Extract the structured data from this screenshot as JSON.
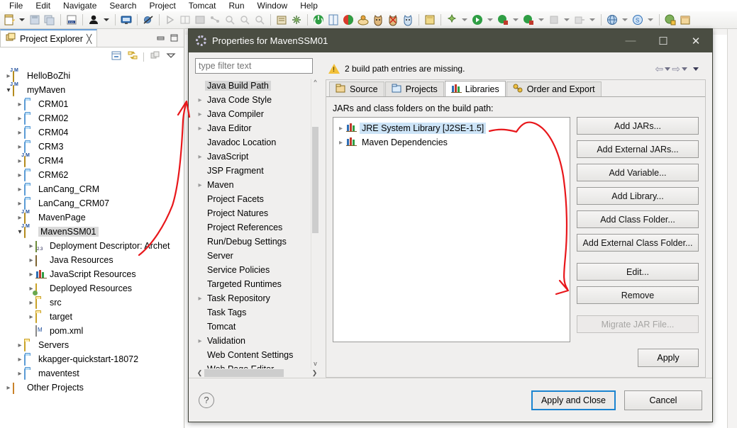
{
  "app": {
    "menu": [
      "File",
      "Edit",
      "Navigate",
      "Search",
      "Project",
      "Tomcat",
      "Run",
      "Window",
      "Help"
    ],
    "toolbar_icons": [
      "new-wizard-icon",
      "new-dropdown-caret",
      "save-icon",
      "save-all-icon",
      "new-java-class-icon",
      "user-icon",
      "user-dropdown-caret",
      "console-icon",
      "skip-breakpoints-icon",
      "run-last-tool-icon",
      "toggle-mark-occurrences-icon",
      "open-type-icon",
      "link-icon",
      "cat-icon-1",
      "cat-icon-2",
      "cat-icon-3",
      "power-icon",
      "perspective-icon",
      "refresh-icon",
      "search-icon-1",
      "search-icon-2",
      "search-icon-3",
      "save-doc-icon",
      "debug-icon",
      "debug-caret",
      "run-icon",
      "run-caret",
      "coverage-icon",
      "coverage-caret",
      "profile-icon",
      "profile-caret",
      "external-tools-icon",
      "external-tools-caret",
      "build-icon",
      "build-caret",
      "web-browser-icon",
      "browser-caret",
      "js-icon",
      "js-caret",
      "open-perspective-icon",
      "perspective-switch-icon"
    ]
  },
  "explorer": {
    "tab_label": "Project Explorer",
    "close_glyph": "╳",
    "minimize_glyph": "—",
    "maximize_glyph": "□",
    "tools": [
      "collapse-all-icon",
      "link-with-editor-icon",
      "focus-on-active-task-icon",
      "view-menu-icon"
    ],
    "tree": [
      {
        "label": "HelloBoZhi",
        "indent": 0,
        "state": "collapsed",
        "icon": "project-web-icon"
      },
      {
        "label": "myMaven",
        "indent": 0,
        "state": "expanded",
        "icon": "project-web-icon"
      },
      {
        "label": "CRM01",
        "indent": 1,
        "state": "collapsed",
        "icon": "folder-blue-icon"
      },
      {
        "label": "CRM02",
        "indent": 1,
        "state": "collapsed",
        "icon": "folder-blue-icon"
      },
      {
        "label": "CRM04",
        "indent": 1,
        "state": "collapsed",
        "icon": "folder-blue-icon"
      },
      {
        "label": "CRM3",
        "indent": 1,
        "state": "collapsed",
        "icon": "folder-blue-icon"
      },
      {
        "label": "CRM4",
        "indent": 1,
        "state": "collapsed",
        "icon": "maven-project-icon"
      },
      {
        "label": "CRM62",
        "indent": 1,
        "state": "collapsed",
        "icon": "folder-blue-icon"
      },
      {
        "label": "LanCang_CRM",
        "indent": 1,
        "state": "collapsed",
        "icon": "folder-blue-icon"
      },
      {
        "label": "LanCang_CRM07",
        "indent": 1,
        "state": "collapsed",
        "icon": "folder-blue-icon"
      },
      {
        "label": "MavenPage",
        "indent": 1,
        "state": "collapsed",
        "icon": "maven-project-icon"
      },
      {
        "label": "MavenSSM01",
        "indent": 1,
        "state": "expanded",
        "icon": "maven-project-icon",
        "selected": true
      },
      {
        "label": "Deployment Descriptor: Archet",
        "indent": 2,
        "state": "collapsed",
        "icon": "deployment-descriptor-icon"
      },
      {
        "label": "Java Resources",
        "indent": 2,
        "state": "collapsed",
        "icon": "java-resources-icon"
      },
      {
        "label": "JavaScript Resources",
        "indent": 2,
        "state": "collapsed",
        "icon": "library-icon"
      },
      {
        "label": "Deployed Resources",
        "indent": 2,
        "state": "collapsed",
        "icon": "deployed-resources-icon"
      },
      {
        "label": "src",
        "indent": 2,
        "state": "collapsed",
        "icon": "folder-open-icon"
      },
      {
        "label": "target",
        "indent": 2,
        "state": "collapsed",
        "icon": "folder-open-icon"
      },
      {
        "label": "pom.xml",
        "indent": 2,
        "state": "leaf",
        "icon": "xml-file-icon"
      },
      {
        "label": "Servers",
        "indent": 1,
        "state": "collapsed",
        "icon": "folder-open-icon"
      },
      {
        "label": "kkapger-quickstart-18072",
        "indent": 1,
        "state": "collapsed",
        "icon": "folder-blue-icon"
      },
      {
        "label": "maventest",
        "indent": 1,
        "state": "collapsed",
        "icon": "folder-blue-icon"
      },
      {
        "label": "Other Projects",
        "indent": 0,
        "state": "collapsed",
        "icon": "other-projects-icon"
      }
    ]
  },
  "dialog": {
    "title": "Properties for MavenSSM01",
    "window_buttons": {
      "minimize": "—",
      "maximize": "☐",
      "close": "✕"
    },
    "filter_placeholder": "type filter text",
    "message": "2 build path entries are missing.",
    "nav": [
      {
        "label": "Java Build Path",
        "expandable": false,
        "selected": true
      },
      {
        "label": "Java Code Style",
        "expandable": true
      },
      {
        "label": "Java Compiler",
        "expandable": true
      },
      {
        "label": "Java Editor",
        "expandable": true
      },
      {
        "label": "Javadoc Location",
        "expandable": false
      },
      {
        "label": "JavaScript",
        "expandable": true
      },
      {
        "label": "JSP Fragment",
        "expandable": false
      },
      {
        "label": "Maven",
        "expandable": true
      },
      {
        "label": "Project Facets",
        "expandable": false
      },
      {
        "label": "Project Natures",
        "expandable": false
      },
      {
        "label": "Project References",
        "expandable": false
      },
      {
        "label": "Run/Debug Settings",
        "expandable": false
      },
      {
        "label": "Server",
        "expandable": false
      },
      {
        "label": "Service Policies",
        "expandable": false
      },
      {
        "label": "Targeted Runtimes",
        "expandable": false
      },
      {
        "label": "Task Repository",
        "expandable": true
      },
      {
        "label": "Task Tags",
        "expandable": false
      },
      {
        "label": "Tomcat",
        "expandable": false
      },
      {
        "label": "Validation",
        "expandable": true
      },
      {
        "label": "Web Content Settings",
        "expandable": false
      },
      {
        "label": "Web Page Editor",
        "expandable": false
      }
    ],
    "tabs": [
      {
        "label": "Source",
        "icon": "source-folder-icon",
        "active": false
      },
      {
        "label": "Projects",
        "icon": "projects-icon",
        "active": false
      },
      {
        "label": "Libraries",
        "icon": "libraries-icon",
        "active": true
      },
      {
        "label": "Order and Export",
        "icon": "order-export-icon",
        "active": false
      }
    ],
    "panel_title": "JARs and class folders on the build path:",
    "libraries": [
      {
        "label": "JRE System Library [J2SE-1.5]",
        "selected": true
      },
      {
        "label": "Maven Dependencies",
        "selected": false
      }
    ],
    "side_buttons": [
      {
        "label": "Add JARs...",
        "enabled": true
      },
      {
        "label": "Add External JARs...",
        "enabled": true
      },
      {
        "label": "Add Variable...",
        "enabled": true
      },
      {
        "label": "Add Library...",
        "enabled": true
      },
      {
        "label": "Add Class Folder...",
        "enabled": true
      },
      {
        "label": "Add External Class Folder...",
        "enabled": true
      },
      {
        "label": "Edit...",
        "enabled": true
      },
      {
        "label": "Remove",
        "enabled": true
      },
      {
        "label": "Migrate JAR File...",
        "enabled": false
      }
    ],
    "apply_label": "Apply",
    "help_glyph": "?",
    "apply_and_close_label": "Apply and Close",
    "cancel_label": "Cancel"
  },
  "annotations": {
    "color": "#e8171b",
    "arrow_left_name": "red-arrow-to-dialog",
    "arrow_right_name": "red-arrow-to-remove-button"
  },
  "colors": {
    "title_bar": "#4a4d42",
    "selection_blue": "#cde4f7",
    "focus_blue": "#1b84d0",
    "warning_yellow": "#f3c13a"
  }
}
